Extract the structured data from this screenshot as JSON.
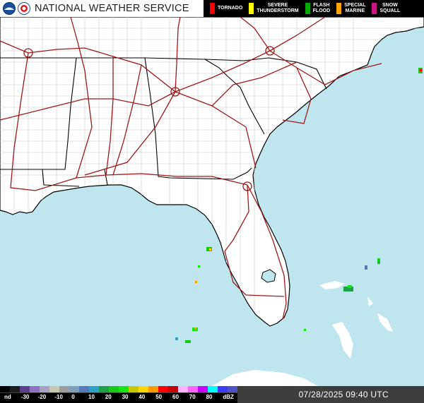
{
  "header": {
    "agency_title": "NATIONAL WEATHER SERVICE",
    "logos": [
      "noaa-logo",
      "nws-logo"
    ]
  },
  "warnings_legend": [
    {
      "label": "TORNADO",
      "color": "#ff0000"
    },
    {
      "label": "SEVERE\nTHUNDERSTORM",
      "color": "#ffff00"
    },
    {
      "label": "FLASH\nFLOOD",
      "color": "#00aa00"
    },
    {
      "label": "SPECIAL\nMARINE",
      "color": "#ffa500"
    },
    {
      "label": "SNOW\nSQUALL",
      "color": "#c71585"
    }
  ],
  "reflectivity_scale": {
    "labels": [
      "nd",
      "-30",
      "-20",
      "-10",
      "0",
      "10",
      "20",
      "30",
      "40",
      "50",
      "60",
      "70",
      "80",
      "dBZ"
    ],
    "colors": [
      "#000000",
      "#1c1c1c",
      "#5a3f8f",
      "#8f6fbf",
      "#a8a0c0",
      "#c8c8b0",
      "#9c9c9c",
      "#7f9fbf",
      "#5a78b8",
      "#2fa0c8",
      "#1ea04a",
      "#19c819",
      "#14e614",
      "#c8c800",
      "#ffd700",
      "#ff9a00",
      "#ff0000",
      "#c80000",
      "#ffb4ff",
      "#ff64ff",
      "#c800ff",
      "#00ffff",
      "#3c3cff",
      "#5050c8"
    ]
  },
  "timestamp": "07/28/2025 09:40 UTC",
  "map": {
    "region": "Southeast United States",
    "colors": {
      "land": "#ffffff",
      "water": "#bfe6ee",
      "highway": "#9c1a1a",
      "state_border": "#000000",
      "county_border": "#b4b4b4"
    }
  }
}
